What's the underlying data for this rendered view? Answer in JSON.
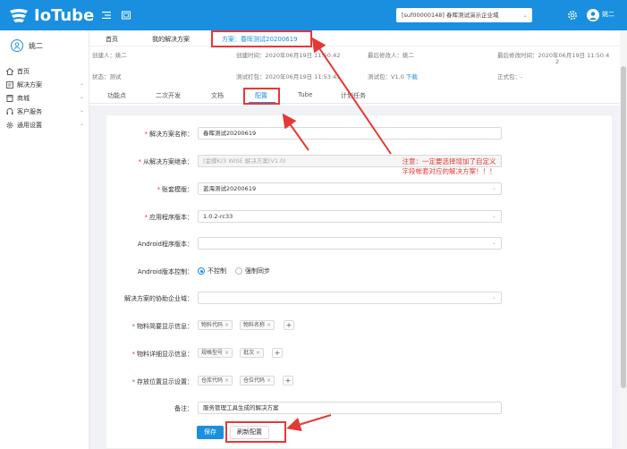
{
  "header": {
    "app_name": "IoTube",
    "tenant": "[suf00000148] 春晖测试演示企业域",
    "user": "姚二"
  },
  "sidebar": {
    "user": "姚二",
    "items": [
      {
        "label": "首页",
        "icon": "home-icon",
        "has_children": false
      },
      {
        "label": "解决方案",
        "icon": "solution-icon",
        "has_children": true
      },
      {
        "label": "商城",
        "icon": "store-icon",
        "has_children": true
      },
      {
        "label": "客户服务",
        "icon": "headset-icon",
        "has_children": true
      },
      {
        "label": "通用设置",
        "icon": "gear-icon",
        "has_children": true
      }
    ]
  },
  "top_tabs": [
    {
      "label": "首页"
    },
    {
      "label": "我的解决方案"
    },
    {
      "label": "方案：春晖测试20200619",
      "active": true
    }
  ],
  "info": {
    "creator_label": "创建人：",
    "creator": "姚二",
    "created_label": "创建时间：",
    "created": "2020年06月19日 11:50:42",
    "modifier_label": "最后修改人：",
    "modifier": "姚二",
    "modified_label": "最后修改时间：",
    "modified_1": "2020年06月19日 11:50:4",
    "modified_2": "2",
    "status_label": "状态：",
    "status": "测试",
    "packed_label": "测试打包：",
    "packed": "2020年06月19日 11:53:45",
    "testpkg_label": "测试包：",
    "testpkg_version": "V1.0",
    "download": "下载",
    "release_label": "正式包：",
    "release": "-"
  },
  "sub_tabs": [
    {
      "label": "功能点"
    },
    {
      "label": "二次开发"
    },
    {
      "label": "文档"
    },
    {
      "label": "配置",
      "active": true
    },
    {
      "label": "Tube"
    },
    {
      "label": "计划任务"
    }
  ],
  "form": {
    "solution_name_label": "解决方案名称：",
    "solution_name": "春晖测试20200619",
    "derived_label": "从解决方案继承：",
    "derived": "[金蝶K/3 WISE 解决方案(V1.0)",
    "account_label": "账套模版：",
    "account": "蓝海测试20200619",
    "app_version_label": "应用程序版本：",
    "app_version": "1.0.2-rc33",
    "android_version_label": "Android程序版本：",
    "android_version": "",
    "android_ctrl_label": "Android版本控制：",
    "android_ctrl_options": [
      "不控制",
      "强制同步"
    ],
    "coop_label": "解决方案的协助企业域：",
    "coop": "",
    "brief_label": "物料简要显示信息：",
    "brief_tags": [
      "物料代码",
      "物料名称"
    ],
    "detail_label": "物料详细显示信息：",
    "detail_tags": [
      "规格型号",
      "批次"
    ],
    "storage_label": "存放位置显示设置：",
    "storage_tags": [
      "仓库代码",
      "仓位代码"
    ],
    "remark_label": "备注：",
    "remark": "服务管理工具生成的解决方案",
    "save": "保存",
    "reset": "刷新配置"
  },
  "annotation": {
    "line1": "注意：一定要选择增加了自定义",
    "line2": "字段帐套对应的解决方案！！！"
  },
  "colors": {
    "primary": "#1a8fe0",
    "annotation": "#e53935"
  }
}
